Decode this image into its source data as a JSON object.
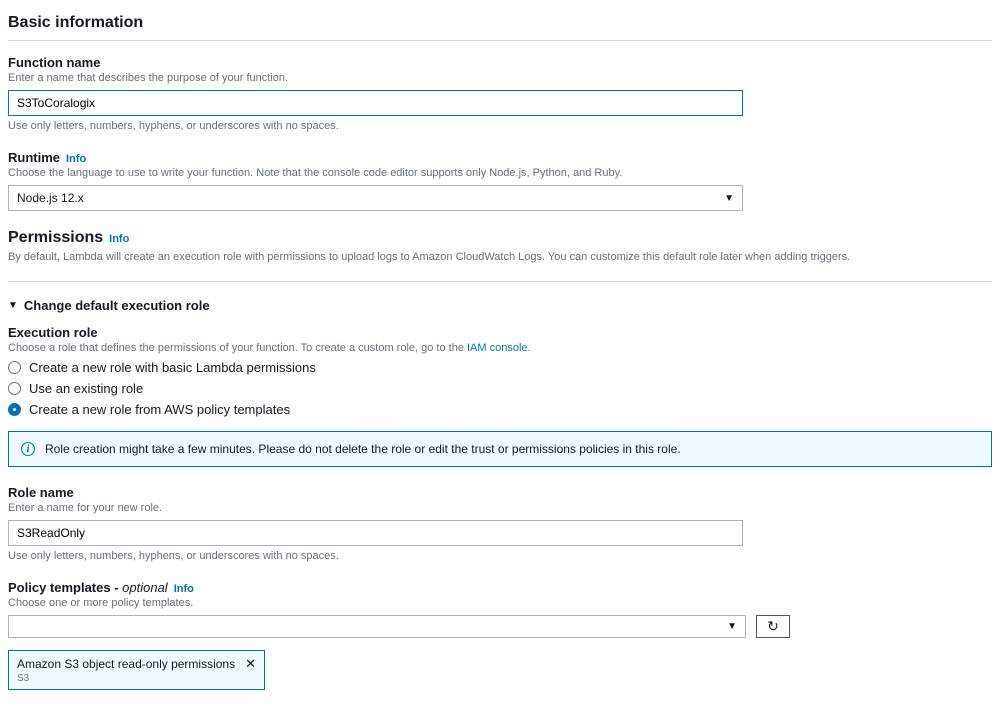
{
  "header": {
    "title": "Basic information"
  },
  "functionName": {
    "label": "Function name",
    "desc": "Enter a name that describes the purpose of your function.",
    "value": "S3ToCoralogix",
    "help": "Use only letters, numbers, hyphens, or underscores with no spaces."
  },
  "runtime": {
    "label": "Runtime",
    "info": "Info",
    "desc": "Choose the language to use to write your function. Note that the console code editor supports only Node.js, Python, and Ruby.",
    "value": "Node.js 12.x"
  },
  "permissions": {
    "title": "Permissions",
    "info": "Info",
    "desc": "By default, Lambda will create an execution role with permissions to upload logs to Amazon CloudWatch Logs. You can customize this default role later when adding triggers."
  },
  "expander": {
    "label": "Change default execution role"
  },
  "executionRole": {
    "label": "Execution role",
    "descPrefix": "Choose a role that defines the permissions of your function. To create a custom role, go to the ",
    "linkText": "IAM console",
    "options": {
      "a": "Create a new role with basic Lambda permissions",
      "b": "Use an existing role",
      "c": "Create a new role from AWS policy templates"
    }
  },
  "alert": {
    "text": "Role creation might take a few minutes. Please do not delete the role or edit the trust or permissions policies in this role."
  },
  "roleName": {
    "label": "Role name",
    "desc": "Enter a name for your new role.",
    "value": "S3ReadOnly",
    "help": "Use only letters, numbers, hyphens, or underscores with no spaces."
  },
  "policy": {
    "labelPrefix": "Policy templates - ",
    "labelItalic": "optional",
    "info": "Info",
    "desc": "Choose one or more policy templates.",
    "tag": {
      "title": "Amazon S3 object read-only permissions",
      "sub": "S3"
    }
  }
}
